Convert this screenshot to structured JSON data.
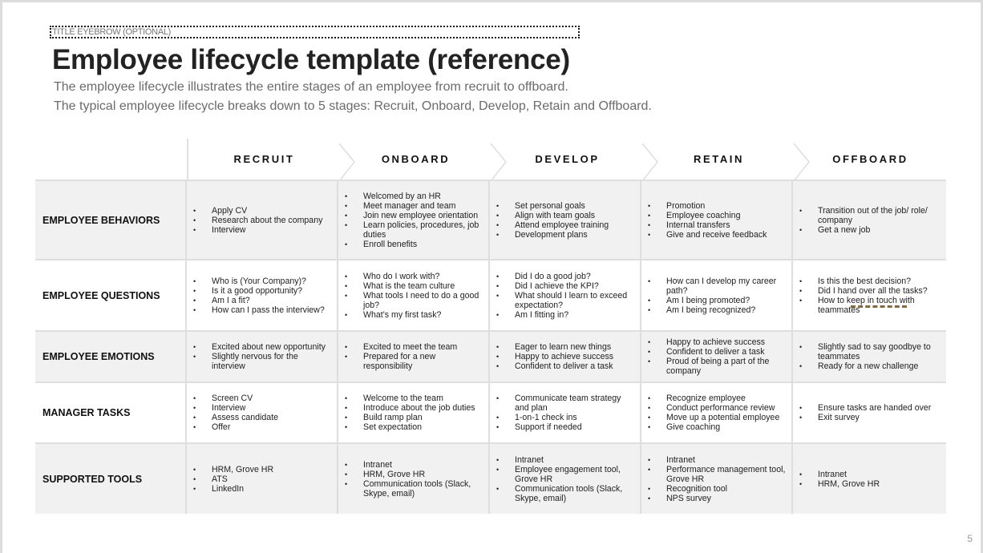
{
  "slide": {
    "eyebrow": "TITLE EYEBROW (OPTIONAL)",
    "title": "Employee lifecycle template (reference)",
    "description_line1": "The employee lifecycle illustrates the entire stages of an employee from recruit to offboard.",
    "description_line2": "The typical employee lifecycle breaks down to 5 stages: Recruit, Onboard, Develop, Retain and Offboard.",
    "page_number": "5"
  },
  "table": {
    "stages": [
      "RECRUIT",
      "ONBOARD",
      "DEVELOP",
      "RETAIN",
      "OFFBOARD"
    ],
    "rows": [
      {
        "label": "EMPLOYEE BEHAVIORS",
        "cells": [
          [
            "Apply CV",
            "Research about the company",
            "Interview"
          ],
          [
            "Welcomed by an HR",
            "Meet manager and team",
            "Join new employee orientation",
            "Learn policies, procedures, job duties",
            "Enroll benefits"
          ],
          [
            "Set personal goals",
            "Align with team goals",
            "Attend employee training",
            "Development plans"
          ],
          [
            "Promotion",
            "Employee coaching",
            "Internal transfers",
            "Give and receive feedback"
          ],
          [
            "Transition out of the job/ role/ company",
            "Get a new job"
          ]
        ]
      },
      {
        "label": "EMPLOYEE QUESTIONS",
        "cells": [
          [
            "Who is (Your Company)?",
            "Is it a good opportunity?",
            "Am I a fit?",
            "How can I pass the interview?"
          ],
          [
            "Who do I work with?",
            "What is the team culture",
            "What tools I need to do a good job?",
            "What's my first task?"
          ],
          [
            "Did I do a good job?",
            "Did I achieve the KPI?",
            "What should I learn to exceed expectation?",
            "Am I fitting in?"
          ],
          [
            "How can I develop my career path?",
            "Am I being promoted?",
            "Am I being recognized?"
          ],
          [
            "Is this the best decision?",
            "Did I hand over all the tasks?",
            "How to keep in touch with teammates"
          ]
        ]
      },
      {
        "label": "EMPLOYEE EMOTIONS",
        "cells": [
          [
            "Excited about new opportunity",
            "Slightly nervous for the interview"
          ],
          [
            "Excited to meet the team",
            "Prepared for a new responsibility"
          ],
          [
            "Eager to learn new things",
            "Happy to achieve success",
            "Confident to deliver a task"
          ],
          [
            "Happy to achieve success",
            "Confident to deliver a task",
            "Proud of being a part of the company"
          ],
          [
            "Slightly sad to say goodbye to teammates",
            "Ready for a new challenge"
          ]
        ]
      },
      {
        "label": "MANAGER TASKS",
        "cells": [
          [
            "Screen CV",
            "Interview",
            "Assess candidate",
            "Offer"
          ],
          [
            "Welcome to the team",
            "Introduce about the job duties",
            "Build ramp plan",
            "Set expectation"
          ],
          [
            "Communicate team strategy and plan",
            "1-on-1 check ins",
            "Support if needed"
          ],
          [
            "Recognize employee",
            "Conduct performance review",
            "Move up a potential employee",
            "Give coaching"
          ],
          [
            "Ensure tasks are handed over",
            "Exit survey"
          ]
        ]
      },
      {
        "label": "SUPPORTED TOOLS",
        "cells": [
          [
            "HRM, Grove HR",
            "ATS",
            "LinkedIn"
          ],
          [
            "Intranet",
            "HRM, Grove HR",
            "Communication tools (Slack, Skype, email)"
          ],
          [
            "Intranet",
            "Employee engagement tool, Grove HR",
            "Communication tools (Slack, Skype, email)"
          ],
          [
            "Intranet",
            "Performance management tool, Grove HR",
            "Recognition tool",
            "NPS survey"
          ],
          [
            "Intranet",
            "HRM, Grove HR"
          ]
        ]
      }
    ]
  }
}
